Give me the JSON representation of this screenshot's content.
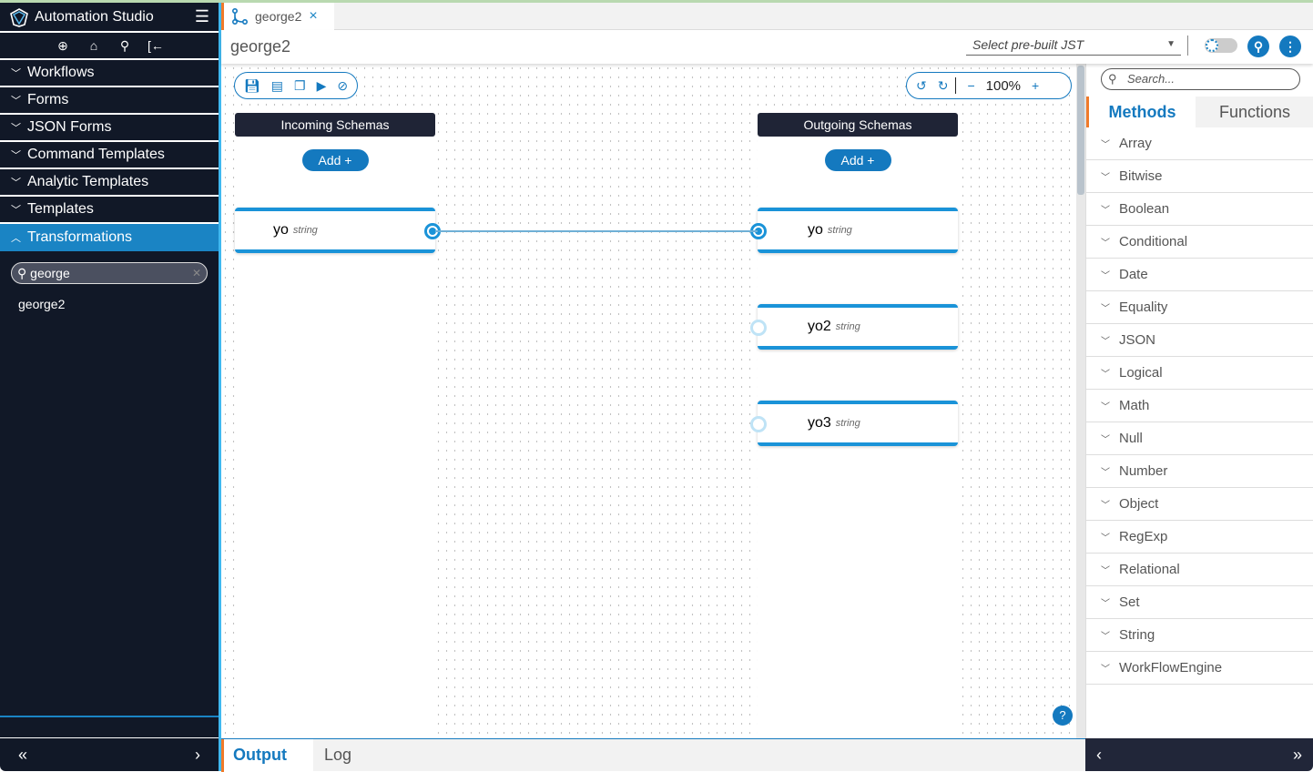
{
  "app": {
    "title": "Automation Studio"
  },
  "sidebar": {
    "items": [
      {
        "label": "Workflows"
      },
      {
        "label": "Forms"
      },
      {
        "label": "JSON Forms"
      },
      {
        "label": "Command Templates"
      },
      {
        "label": "Analytic Templates"
      },
      {
        "label": "Templates"
      },
      {
        "label": "Transformations"
      }
    ],
    "filter_value": "george",
    "results": [
      "george2"
    ],
    "collapse": "«",
    "expand": "›"
  },
  "tab": {
    "label": "george2",
    "close": "×"
  },
  "header": {
    "title": "george2",
    "jst_placeholder": "Select pre-built JST"
  },
  "canvas": {
    "zoom": "100%",
    "incoming": {
      "title": "Incoming Schemas",
      "add": "Add  +",
      "fields": [
        {
          "name": "yo",
          "type": "string"
        }
      ]
    },
    "outgoing": {
      "title": "Outgoing Schemas",
      "add": "Add  +",
      "fields": [
        {
          "name": "yo",
          "type": "string"
        },
        {
          "name": "yo2",
          "type": "string"
        },
        {
          "name": "yo3",
          "type": "string"
        }
      ]
    },
    "help": "?"
  },
  "bottom": {
    "tabs": [
      "Output",
      "Log"
    ]
  },
  "right": {
    "search_placeholder": "Search...",
    "tabs": [
      "Methods",
      "Functions"
    ],
    "methods": [
      "Array",
      "Bitwise",
      "Boolean",
      "Conditional",
      "Date",
      "Equality",
      "JSON",
      "Logical",
      "Math",
      "Null",
      "Number",
      "Object",
      "RegExp",
      "Relational",
      "Set",
      "String",
      "WorkFlowEngine"
    ],
    "foot_left": "‹",
    "foot_right": "»"
  },
  "colors": {
    "accent": "#1479bf",
    "sidebar": "#111827",
    "orange": "#f07a2a"
  }
}
